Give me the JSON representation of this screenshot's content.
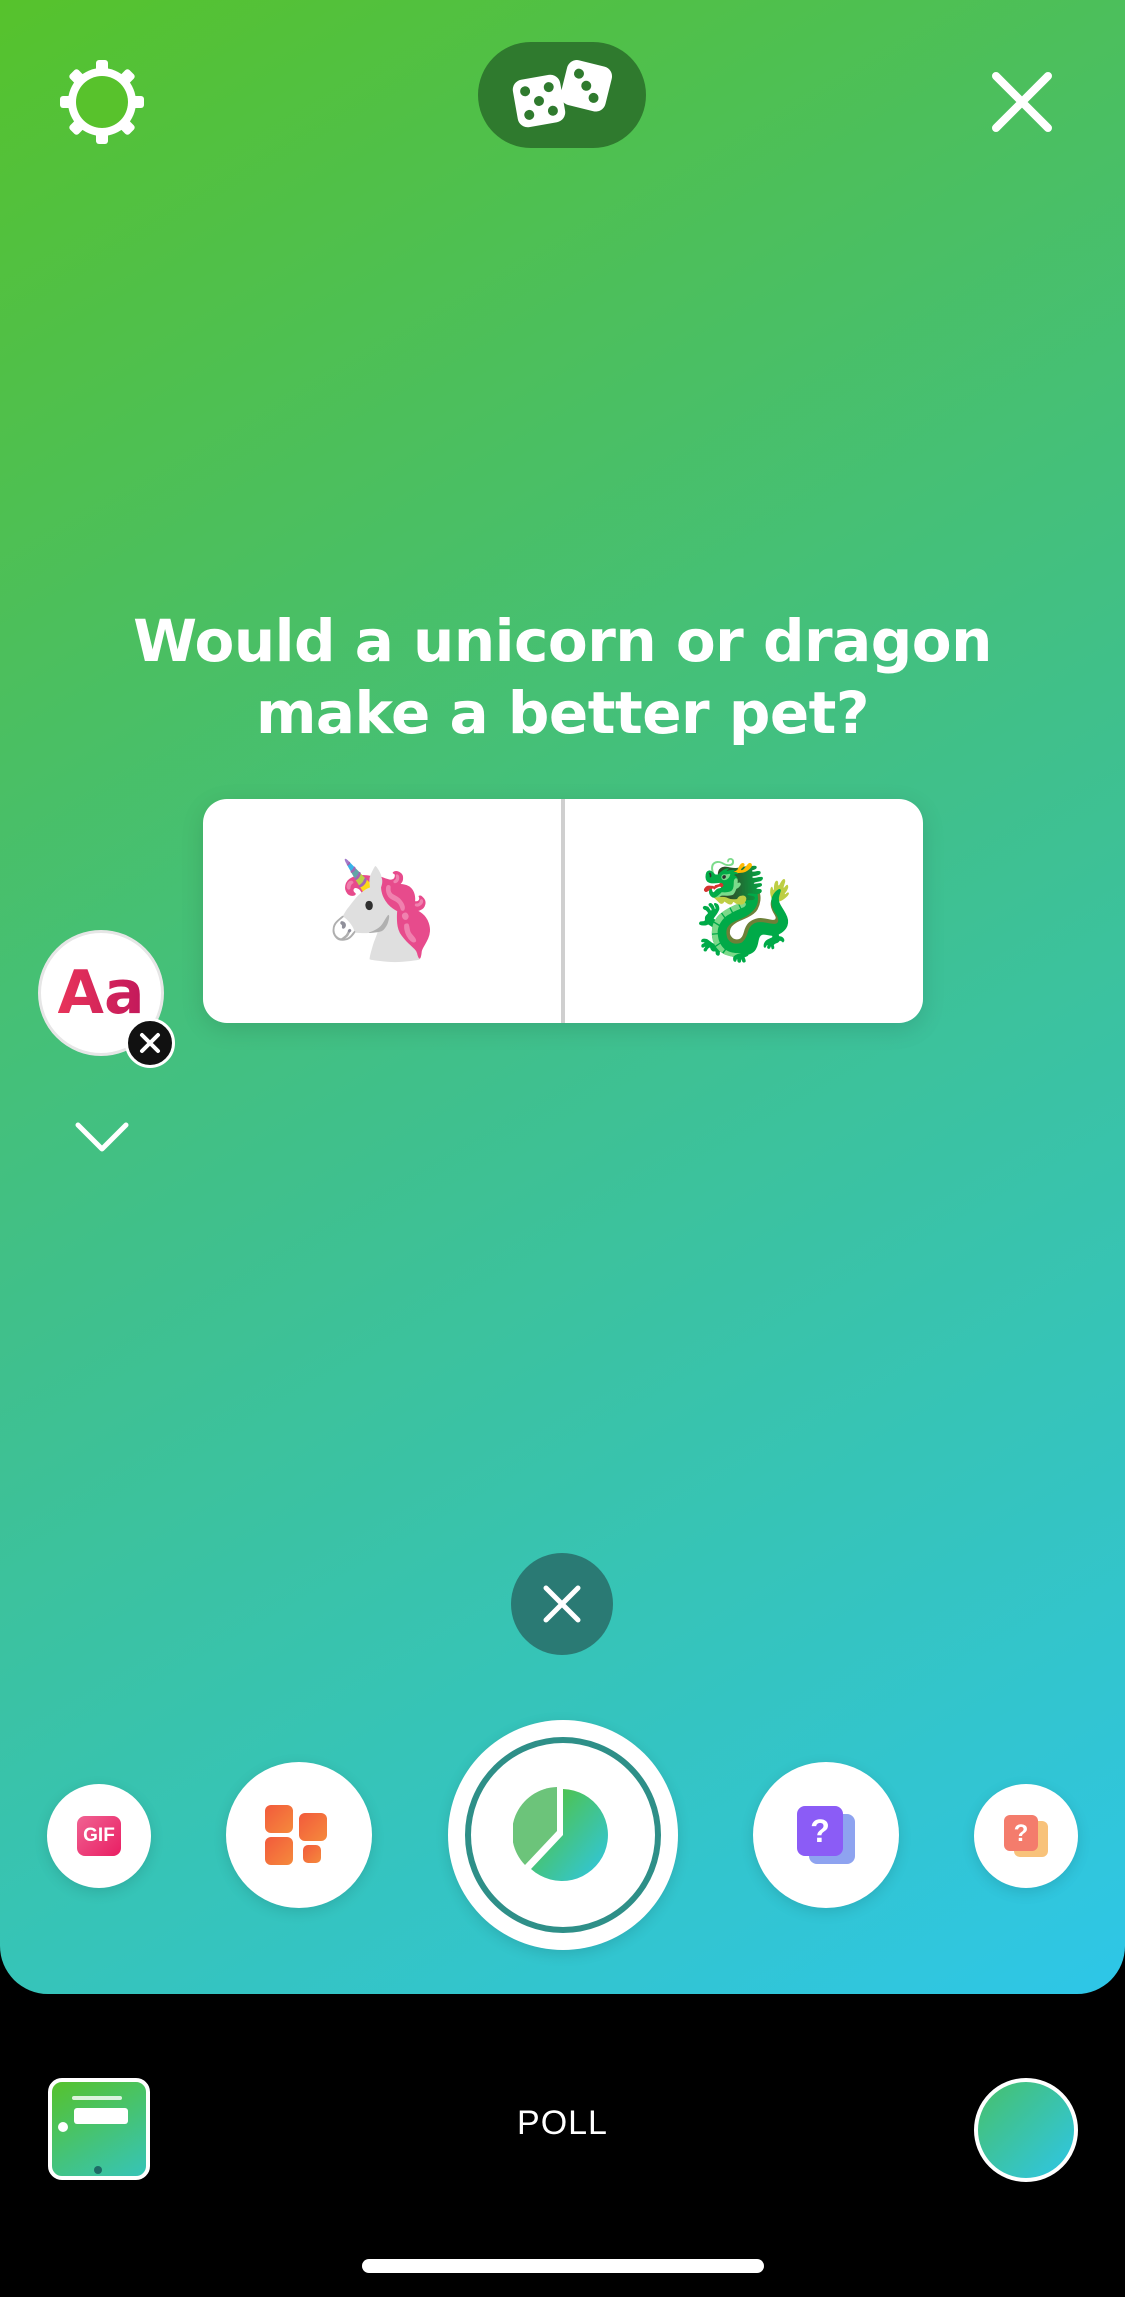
{
  "header": {
    "settings_icon": "gear-icon",
    "randomize_icon": "dice-icon",
    "close_icon": "close-icon"
  },
  "poll": {
    "question": "Would a unicorn or dragon make a better pet?",
    "options": [
      {
        "emoji": "🦄",
        "name": "unicorn"
      },
      {
        "emoji": "🐉",
        "name": "dragon"
      }
    ]
  },
  "side_tools": {
    "font_label": "Aa",
    "remove_icon": "close-icon",
    "expand_icon": "chevron-down-icon"
  },
  "sticker_tray": {
    "gif_label": "GIF",
    "items": [
      "gif-sticker",
      "layout-sticker",
      "poll-sticker",
      "quiz-sticker",
      "quiz-sticker-alt"
    ]
  },
  "bottom_bar": {
    "mode_label": "POLL"
  },
  "colors": {
    "gradient_start": "#56c22c",
    "gradient_end": "#2ec6e8",
    "dice_pill": "#2f7a2e",
    "poll_ring": "#2e8f88"
  }
}
